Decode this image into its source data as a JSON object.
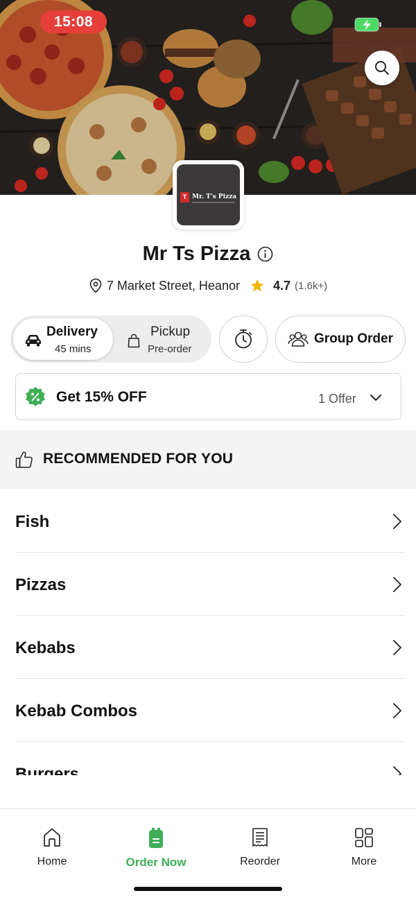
{
  "status": {
    "time": "15:08"
  },
  "store": {
    "logo_text": "Mr. T's Pizza",
    "logo_mark": "T",
    "name": "Mr Ts Pizza",
    "address": "7 Market Street, Heanor",
    "rating": "4.7",
    "rating_count": "(1.6k+)"
  },
  "modes": {
    "delivery_label": "Delivery",
    "delivery_time": "45 mins",
    "pickup_label": "Pickup",
    "pickup_sub": "Pre-order",
    "group_order_label": "Group Order"
  },
  "offer": {
    "title": "Get 15% OFF",
    "count": "1 Offer"
  },
  "recommended": {
    "title": "RECOMMENDED FOR YOU"
  },
  "categories": [
    "Fish",
    "Pizzas",
    "Kebabs",
    "Kebab Combos",
    "Burgers"
  ],
  "nav": [
    {
      "label": "Home",
      "icon": "home-icon"
    },
    {
      "label": "Order Now",
      "icon": "order-icon",
      "active": true
    },
    {
      "label": "Reorder",
      "icon": "receipt-icon"
    },
    {
      "label": "More",
      "icon": "grid-icon"
    }
  ],
  "colors": {
    "accent_green": "#3fae56",
    "status_red": "#e63f3a",
    "star": "#f5b400"
  }
}
